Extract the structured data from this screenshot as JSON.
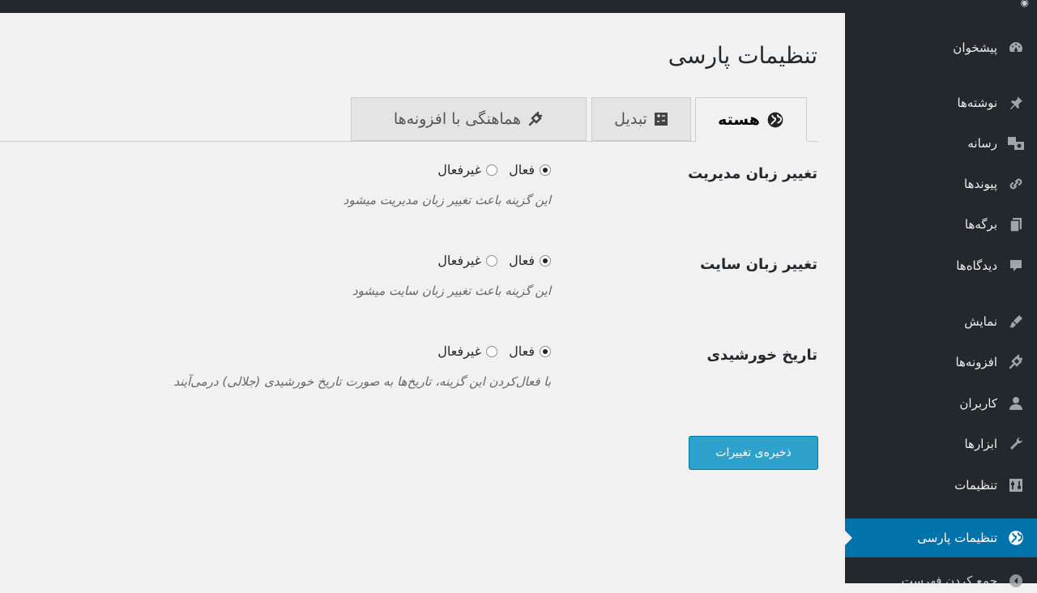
{
  "sidebar": {
    "items": [
      {
        "label": "پیشخوان",
        "icon": "dashboard-icon"
      },
      {
        "label": "نوشته‌ها",
        "icon": "pin-icon"
      },
      {
        "label": "رسانه",
        "icon": "media-icon"
      },
      {
        "label": "پیوندها",
        "icon": "link-icon"
      },
      {
        "label": "برگه‌ها",
        "icon": "pages-icon"
      },
      {
        "label": "دیدگاه‌ها",
        "icon": "comment-icon"
      },
      {
        "label": "نمایش",
        "icon": "appearance-icon"
      },
      {
        "label": "افزونه‌ها",
        "icon": "plugin-icon"
      },
      {
        "label": "کاربران",
        "icon": "user-icon"
      },
      {
        "label": "ابزارها",
        "icon": "wrench-icon"
      },
      {
        "label": "تنظیمات",
        "icon": "settings-icon"
      },
      {
        "label": "تنظیمات پارسی",
        "icon": "globe-icon"
      },
      {
        "label": "جمع کردن فهرست",
        "icon": "collapse-icon"
      }
    ]
  },
  "page": {
    "title": "تنظیمات پارسی"
  },
  "tabs": [
    {
      "label": "هسته",
      "icon": "globe-icon"
    },
    {
      "label": "تبدیل",
      "icon": "convert-icon"
    },
    {
      "label": "هماهنگی با افزونه‌ها",
      "icon": "plugin-icon"
    }
  ],
  "options": {
    "active": "فعال",
    "inactive": "غیرفعال"
  },
  "settings": [
    {
      "label": "تغییر زبان مدیریت",
      "desc": "این گزینه باعث تغییر زبان مدیریت میشود"
    },
    {
      "label": "تغییر زبان سایت",
      "desc": "این گزینه باعث تغییر زبان سایت میشود"
    },
    {
      "label": "تاریخ خورشیدی",
      "desc": "با فعال‌کردن این گزینه، تاریخ‌ها به صورت تاریخ خورشیدی (جلالی) درمی‌آیند"
    }
  ],
  "save_label": "ذخیره‌ی تغییرات",
  "colors": {
    "accent": "#0073aa",
    "button": "#2ea2cc",
    "sidebar": "#23282d",
    "background": "#f1f1f1"
  }
}
